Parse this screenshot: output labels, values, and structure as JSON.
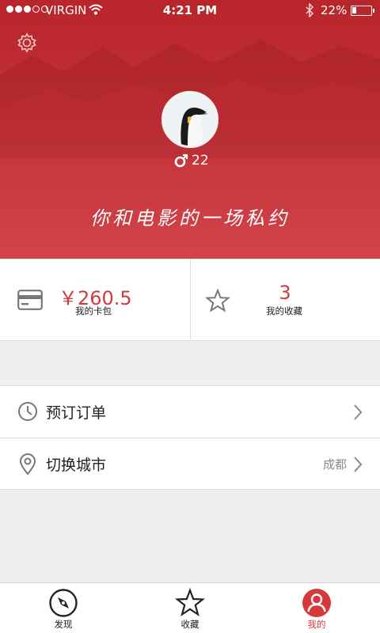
{
  "status_bar": {
    "carrier": "VIRGIN",
    "time": "4:21 PM",
    "battery_percent": "22%",
    "battery_level": 0.22,
    "signal_bars_filled": 3,
    "signal_bars_total": 5
  },
  "profile": {
    "gender_icon": "male-icon",
    "age": "22",
    "slogan": "你和电影的一场私约",
    "avatar_icon": "penguin-avatar"
  },
  "stats": {
    "wallet": {
      "amount": "￥260.5",
      "label": "我的卡包",
      "icon": "card-icon"
    },
    "favorites": {
      "count": "3",
      "label": "我的收藏",
      "icon": "star-icon"
    }
  },
  "menu": {
    "orders": {
      "label": "预订订单",
      "icon": "clock-icon"
    },
    "city": {
      "label": "切换城市",
      "value": "成都",
      "icon": "location-pin-icon"
    }
  },
  "tabbar": {
    "items": [
      {
        "label": "发现",
        "icon": "compass-icon",
        "active": false
      },
      {
        "label": "收藏",
        "icon": "star-icon",
        "active": false
      },
      {
        "label": "我的",
        "icon": "user-icon",
        "active": true
      }
    ]
  },
  "colors": {
    "accent": "#d7383d",
    "header_top": "#b8262c",
    "header_bottom": "#d0444a",
    "divider": "#dedede",
    "page_bg": "#efefef"
  }
}
